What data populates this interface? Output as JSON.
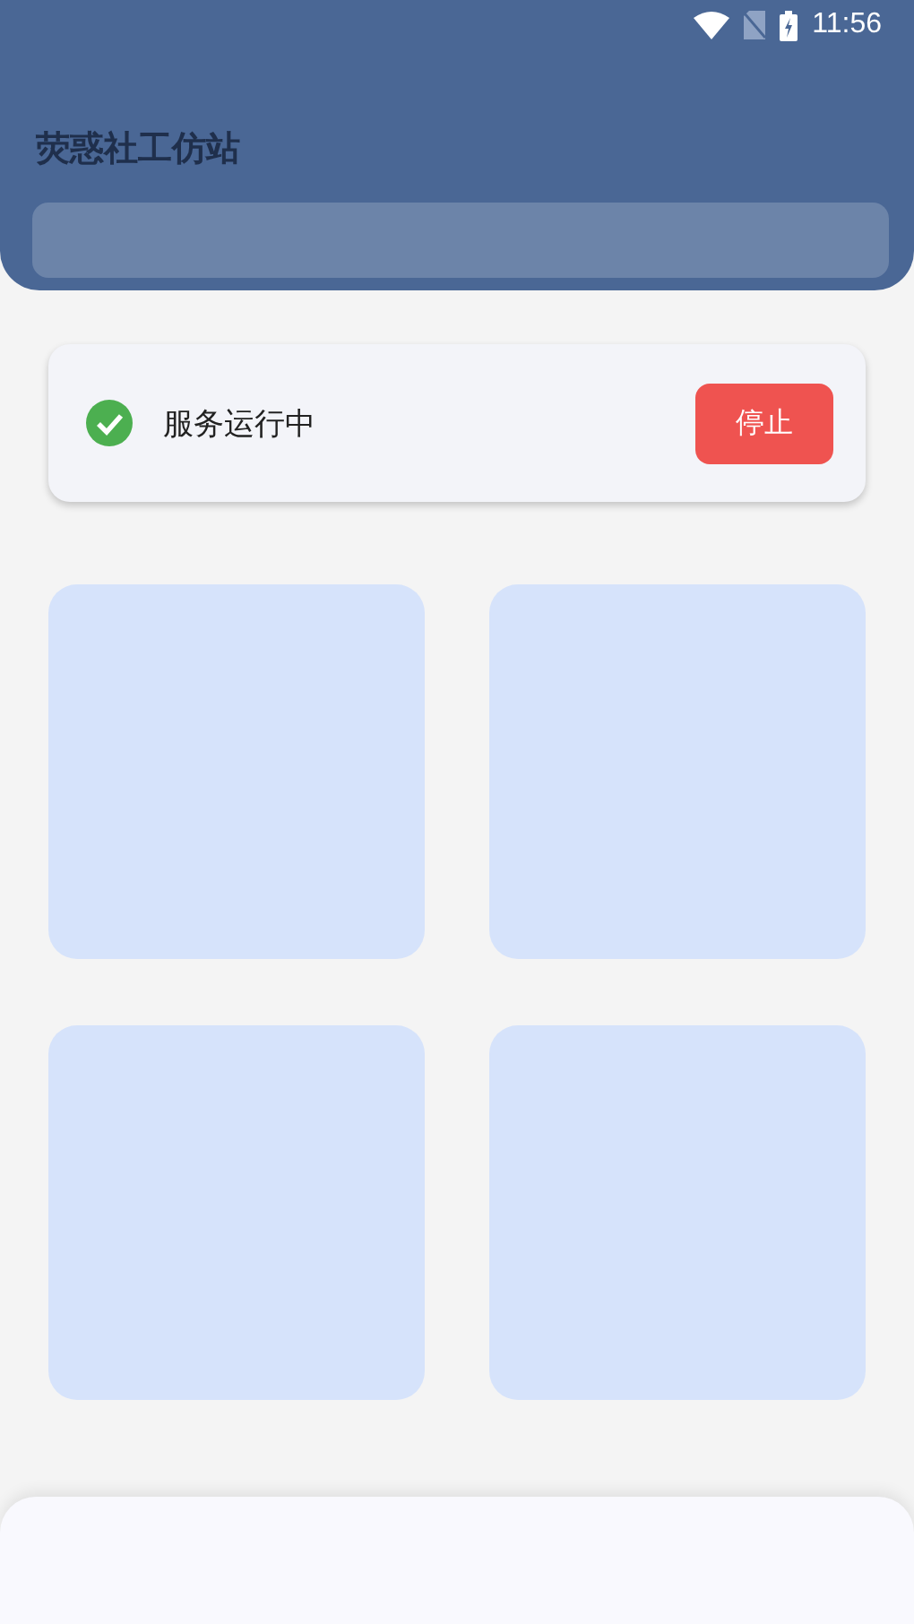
{
  "status_bar": {
    "time": "11:56"
  },
  "header": {
    "title": "荧惑社工仿站"
  },
  "service": {
    "running": true,
    "status": "服务运行中",
    "button": "停止"
  },
  "tiles": [
    {
      "kind": "blank"
    },
    {
      "kind": "blank"
    },
    {
      "kind": "blank"
    },
    {
      "kind": "blank"
    }
  ]
}
